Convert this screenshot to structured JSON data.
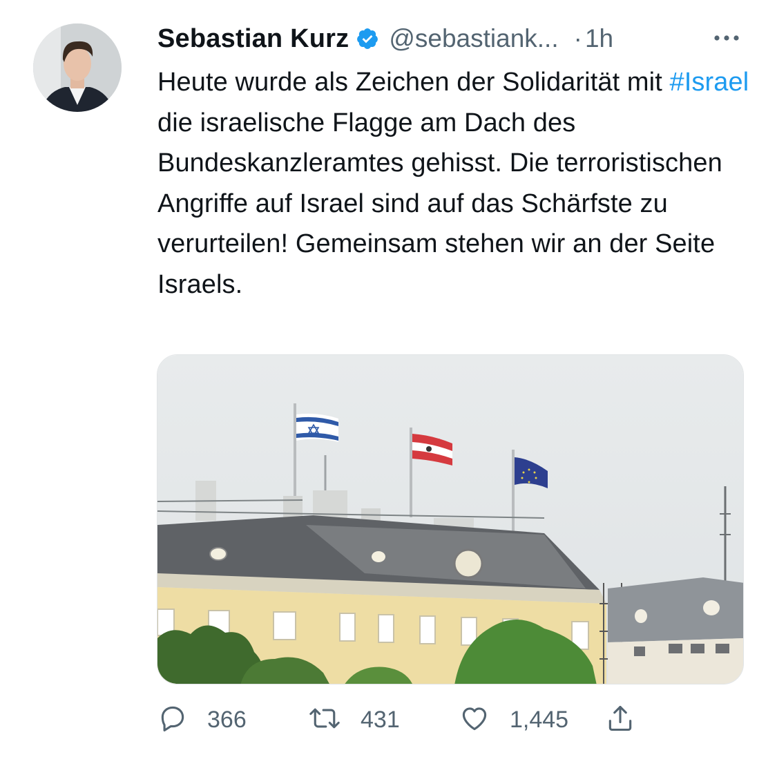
{
  "tweet": {
    "display_name": "Sebastian Kurz",
    "handle": "@sebastiank...",
    "separator": "·",
    "time": "1h",
    "text_before": "Heute wurde als Zeichen der Solidarität mit ",
    "hashtag": "#Israel",
    "text_after": " die israelische Flagge am Dach des Bundeskanzleramtes gehisst. Die terroristischen Angriffe auf Israel sind auf das Schärfste zu verurteilen! Gemeinsam stehen wir an der Seite Israels."
  },
  "actions": {
    "reply_count": "366",
    "retweet_count": "431",
    "like_count": "1,445"
  },
  "icons": {
    "verified": "verified-badge-icon",
    "more": "more-options-icon",
    "reply": "reply-icon",
    "retweet": "retweet-icon",
    "like": "heart-icon",
    "share": "share-icon"
  },
  "colors": {
    "accent": "#1d9bf0",
    "secondary_text": "#536471",
    "text": "#0f1419"
  }
}
